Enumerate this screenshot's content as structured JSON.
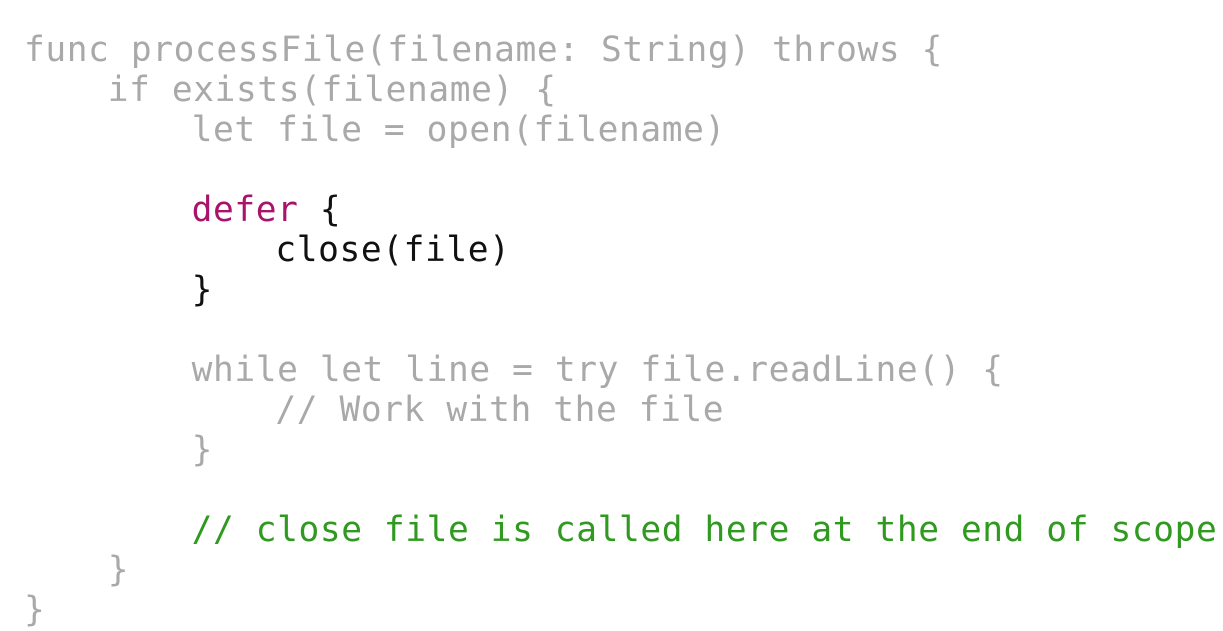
{
  "code": {
    "lines": [
      {
        "indent": 0,
        "segments": [
          {
            "text": "func processFile(filename: String) throws {",
            "style": "dim"
          }
        ]
      },
      {
        "indent": 4,
        "segments": [
          {
            "text": "if exists(filename) {",
            "style": "dim"
          }
        ]
      },
      {
        "indent": 8,
        "segments": [
          {
            "text": "let file = open(filename)",
            "style": "dim"
          }
        ]
      },
      {
        "indent": 0,
        "segments": []
      },
      {
        "indent": 8,
        "segments": [
          {
            "text": "defer",
            "style": "kw"
          },
          {
            "text": " {",
            "style": "txt"
          }
        ]
      },
      {
        "indent": 12,
        "segments": [
          {
            "text": "close(file)",
            "style": "txt"
          }
        ]
      },
      {
        "indent": 8,
        "segments": [
          {
            "text": "}",
            "style": "txt"
          }
        ]
      },
      {
        "indent": 0,
        "segments": []
      },
      {
        "indent": 8,
        "segments": [
          {
            "text": "while let line = try file.readLine() {",
            "style": "dim"
          }
        ]
      },
      {
        "indent": 12,
        "segments": [
          {
            "text": "// Work with the file",
            "style": "dim"
          }
        ]
      },
      {
        "indent": 8,
        "segments": [
          {
            "text": "}",
            "style": "dim"
          }
        ]
      },
      {
        "indent": 0,
        "segments": []
      },
      {
        "indent": 8,
        "segments": [
          {
            "text": "// close file is called here at the end of scope",
            "style": "cm"
          }
        ]
      },
      {
        "indent": 4,
        "segments": [
          {
            "text": "}",
            "style": "dim"
          }
        ]
      },
      {
        "indent": 0,
        "segments": [
          {
            "text": "}",
            "style": "dim"
          }
        ]
      }
    ]
  },
  "colors": {
    "dimmed_code": "#a9a9a9",
    "keyword": "#a9136b",
    "highlighted_code": "#111111",
    "comment": "#2f9a1f",
    "background": "#ffffff"
  }
}
